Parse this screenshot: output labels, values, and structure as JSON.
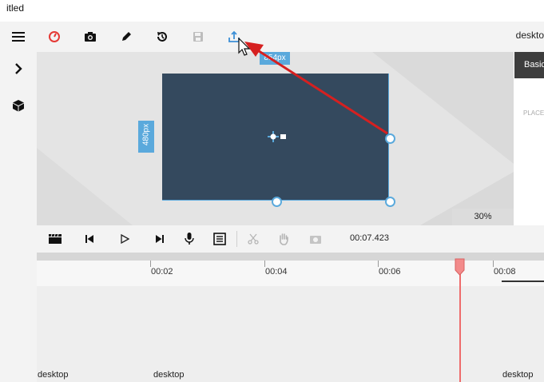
{
  "window": {
    "title": "itled"
  },
  "toolbar": {
    "items": [
      {
        "icon": "record-icon",
        "label": "record"
      },
      {
        "icon": "screenshot-icon",
        "label": "screenshot"
      },
      {
        "icon": "pen-icon",
        "label": "edit"
      },
      {
        "icon": "history-icon",
        "label": "history"
      },
      {
        "icon": "save-icon",
        "label": "save"
      },
      {
        "icon": "export-icon",
        "label": "export"
      }
    ],
    "right_label": "deskto"
  },
  "sidebar": {
    "items": [
      "menu-icon",
      "chevron-right-icon",
      "cube-icon"
    ]
  },
  "canvas": {
    "width_label": "854px",
    "height_label": "480px",
    "zoom": "30%",
    "accent": "#5aa9dc",
    "stage_color": "#34495e"
  },
  "rightpanel": {
    "tab": "Basic",
    "section_label": "PLACE"
  },
  "player": {
    "controls": [
      "clapper-icon",
      "skip-back-icon",
      "play-icon",
      "skip-forward-icon",
      "microphone-icon",
      "captions-icon",
      "scissors-icon",
      "hand-icon",
      "camera-icon"
    ],
    "timecode": "00:07.423"
  },
  "timeline": {
    "ticks": [
      "00:02",
      "00:04",
      "00:06",
      "00:08"
    ],
    "playhead_color": "#ee6b6b",
    "clips": [
      "desktop",
      "desktop",
      "desktop"
    ]
  }
}
